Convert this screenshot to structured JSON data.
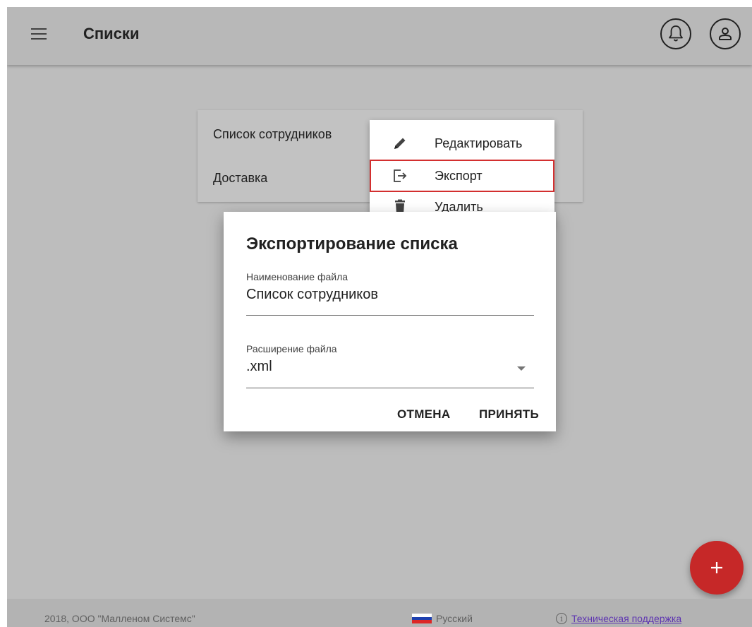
{
  "header": {
    "title": "Списки",
    "menu_icon": "hamburger-icon",
    "notifications_icon": "bell-icon",
    "profile_icon": "user-icon"
  },
  "lists": {
    "items": [
      {
        "label": "Список сотрудников"
      },
      {
        "label": "Доставка"
      }
    ]
  },
  "context_menu": {
    "items": [
      {
        "label": "Редактировать",
        "icon": "pencil-icon"
      },
      {
        "label": "Экспорт",
        "icon": "export-icon",
        "highlighted": true
      },
      {
        "label": "Удалить",
        "icon": "trash-icon"
      }
    ]
  },
  "dialog": {
    "title": "Экспортирование списка",
    "filename": {
      "label": "Наименование файла",
      "value": "Список сотрудников"
    },
    "extension": {
      "label": "Расширение файла",
      "value": ".xml"
    },
    "cancel_label": "ОТМЕНА",
    "accept_label": "ПРИНЯТЬ"
  },
  "fab": {
    "icon": "plus-icon"
  },
  "footer": {
    "copyright": "2018, ООО \"Малленом Системс\"",
    "language": "Русский",
    "support": "Техническая поддержка"
  },
  "colors": {
    "accent": "#c62828",
    "highlight_border": "#d32f2f",
    "link": "#5e35b1"
  }
}
